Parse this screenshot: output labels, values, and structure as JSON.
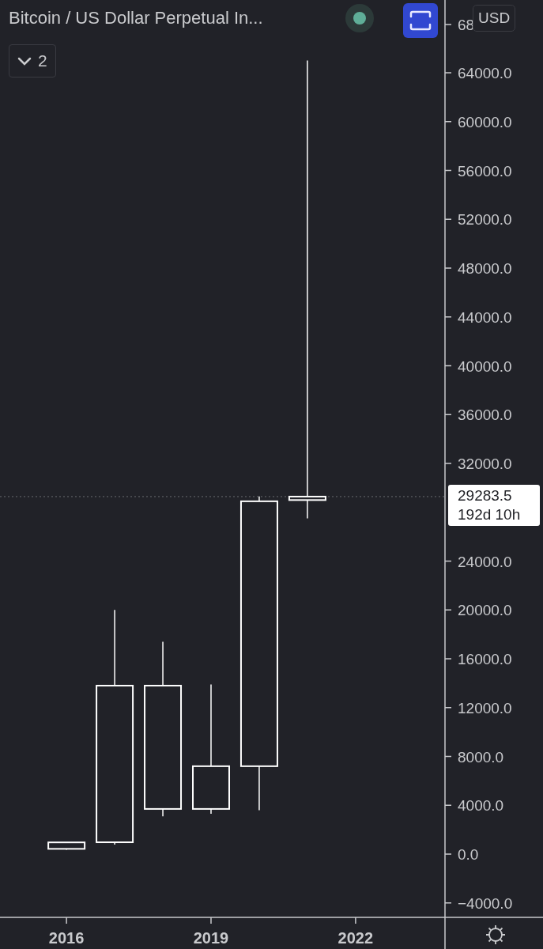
{
  "header": {
    "title": "Bitcoin / US Dollar Perpetual In...",
    "intervals_button": "2",
    "currency_button": "USD"
  },
  "price_axis": {
    "cut_label": "68"
  },
  "price_label": {
    "price": "29283.5",
    "countdown": "192d 10h"
  },
  "chart_data": {
    "type": "candlestick",
    "x": [
      2016,
      2017,
      2018,
      2019,
      2020,
      2021
    ],
    "ohlc": [
      [
        430,
        960,
        360,
        960
      ],
      [
        970,
        20000,
        780,
        13800
      ],
      [
        3700,
        17400,
        3100,
        13800
      ],
      [
        3700,
        13900,
        3300,
        7200
      ],
      [
        7200,
        29300,
        3600,
        28900
      ],
      [
        29000,
        65000,
        27500,
        29283.5
      ]
    ],
    "xlim": [
      2014.62,
      2025.89
    ],
    "ylim": [
      -5182,
      69960
    ],
    "xticks": [
      2016,
      2019,
      2022
    ],
    "yticks": [
      {
        "value": -4000,
        "label": "−4000.0"
      },
      {
        "value": 0,
        "label": "0.0"
      },
      {
        "value": 4000,
        "label": "4000.0"
      },
      {
        "value": 8000,
        "label": "8000.0"
      },
      {
        "value": 12000,
        "label": "12000.0"
      },
      {
        "value": 16000,
        "label": "16000.0"
      },
      {
        "value": 20000,
        "label": "20000.0"
      },
      {
        "value": 24000,
        "label": "24000.0"
      },
      {
        "value": 32000,
        "label": "32000.0"
      },
      {
        "value": 36000,
        "label": "36000.0"
      },
      {
        "value": 40000,
        "label": "40000.0"
      },
      {
        "value": 44000,
        "label": "44000.0"
      },
      {
        "value": 48000,
        "label": "48000.0"
      },
      {
        "value": 52000,
        "label": "52000.0"
      },
      {
        "value": 56000,
        "label": "56000.0"
      },
      {
        "value": 60000,
        "label": "60000.0"
      },
      {
        "value": 64000,
        "label": "64000.0"
      }
    ],
    "ref_lines": [
      {
        "axis": "y",
        "value": 29283.5
      }
    ]
  }
}
